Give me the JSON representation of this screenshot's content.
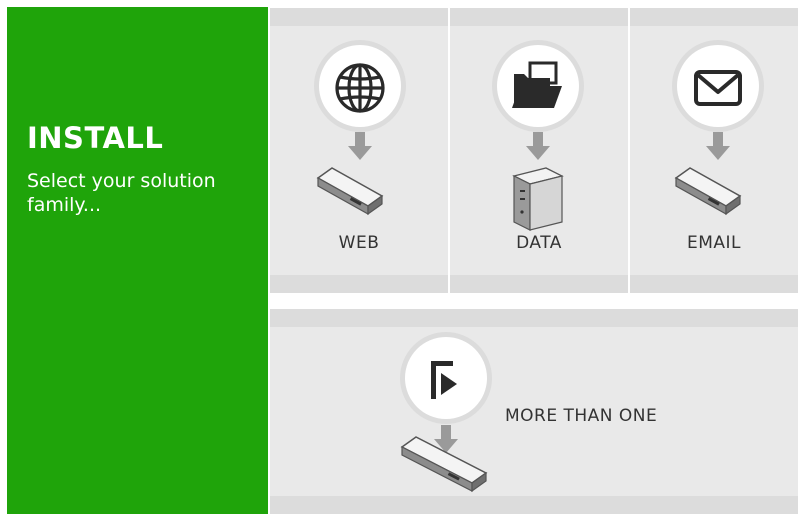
{
  "sidebar": {
    "title": "INSTALL",
    "subtitle": "Select your solution family..."
  },
  "options": {
    "web": {
      "label": "WEB",
      "icon": "globe-icon"
    },
    "data": {
      "label": "DATA",
      "icon": "folder-icon"
    },
    "email": {
      "label": "EMAIL",
      "icon": "envelope-icon"
    },
    "more": {
      "label": "MORE THAN ONE",
      "icon": "play-flag-icon"
    }
  },
  "colors": {
    "accent_green": "#1fa40a",
    "tile_bg": "#e9e9e9",
    "tile_bar": "#dcdcdc",
    "icon_dark": "#2a2a2a"
  }
}
